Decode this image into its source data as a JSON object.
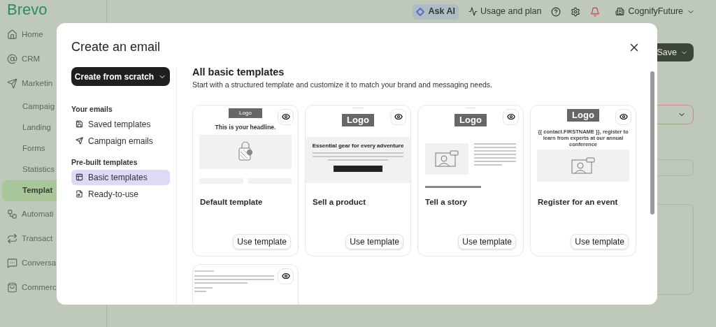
{
  "app": {
    "logo": "Brevo",
    "nav": [
      {
        "label": "Home",
        "kind": "main",
        "selected": false
      },
      {
        "label": "CRM",
        "kind": "main",
        "selected": false
      },
      {
        "label": "Marketin",
        "kind": "main",
        "selected": false
      },
      {
        "label": "Campaig",
        "kind": "sub",
        "selected": false
      },
      {
        "label": "Landing",
        "kind": "sub",
        "selected": false
      },
      {
        "label": "Forms",
        "kind": "sub",
        "selected": false
      },
      {
        "label": "Statistics",
        "kind": "sub",
        "selected": false
      },
      {
        "label": "Templat",
        "kind": "sub",
        "selected": true
      },
      {
        "label": "Automati",
        "kind": "main",
        "selected": false
      },
      {
        "label": "Transact",
        "kind": "main",
        "selected": false
      },
      {
        "label": "Conversa",
        "kind": "main",
        "selected": false
      },
      {
        "label": "Commerc",
        "kind": "main",
        "selected": false
      }
    ],
    "topbar": {
      "ask_ai": "Ask AI",
      "usage": "Usage and plan",
      "account": "CognifyFuture"
    },
    "save_button": "Save"
  },
  "modal": {
    "title": "Create an email",
    "create_button": "Create from scratch",
    "groups": [
      {
        "heading": "Your emails",
        "items": [
          {
            "label": "Saved templates",
            "selected": false
          },
          {
            "label": "Campaign emails",
            "selected": false
          }
        ]
      },
      {
        "heading": "Pre-built templates",
        "items": [
          {
            "label": "Basic templates",
            "selected": true
          },
          {
            "label": "Ready-to-use",
            "selected": false
          }
        ]
      }
    ],
    "heading": "All basic templates",
    "subtitle": "Start with a structured template and customize it to match your brand and messaging needs.",
    "cards": [
      {
        "kind": "default",
        "title": "Default template",
        "button": "Use template",
        "logo": "Logo",
        "headline": "This is your headline."
      },
      {
        "kind": "product",
        "title": "Sell a product",
        "button": "Use template",
        "logo": "Logo",
        "headline": "Essential gear for every adventure"
      },
      {
        "kind": "story",
        "title": "Tell a story",
        "button": "Use template",
        "logo": "Logo"
      },
      {
        "kind": "event",
        "title": "Register for an event",
        "button": "Use template",
        "logo": "Logo",
        "headline": "{{ contact.FIRSTNAME }}, register to learn from experts at our annual conference"
      },
      {
        "kind": "plain"
      }
    ]
  }
}
